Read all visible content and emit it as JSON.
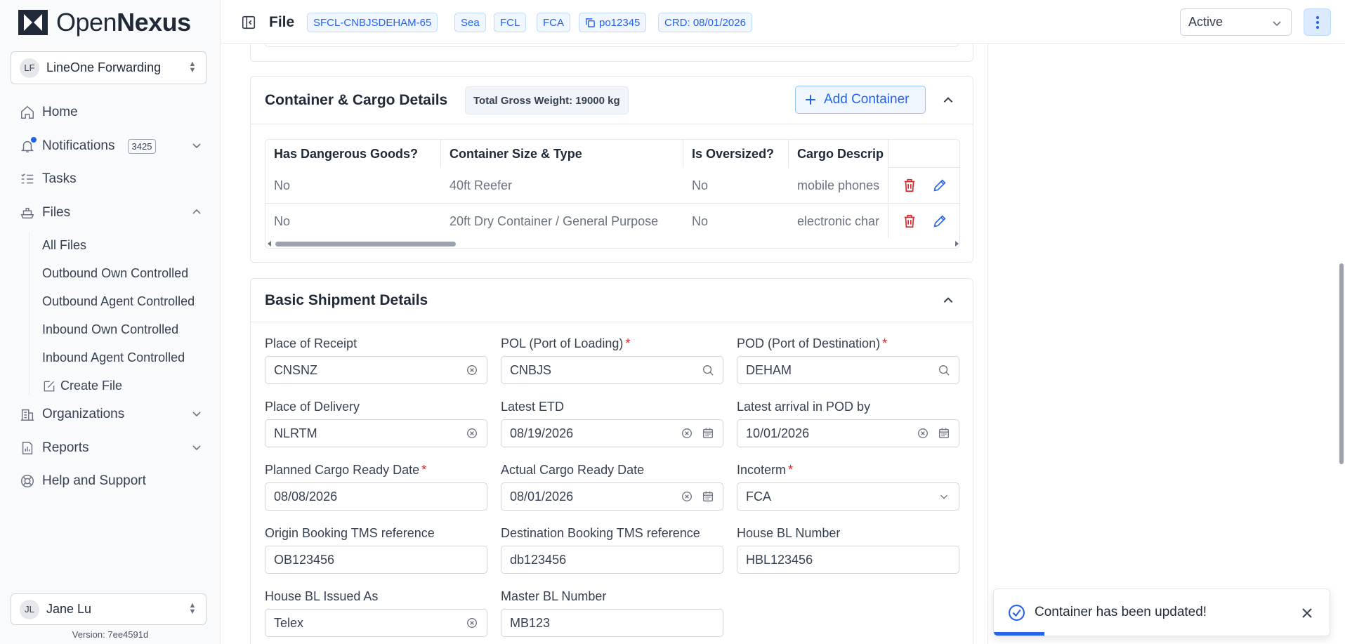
{
  "brand": {
    "name_light": "Open",
    "name_bold": "Nexus"
  },
  "org": {
    "initials": "LF",
    "name": "LineOne Forwarding"
  },
  "nav": {
    "home": "Home",
    "notifications": "Notifications",
    "notifications_count": "3425",
    "tasks": "Tasks",
    "files": "Files",
    "files_sub": [
      "All Files",
      "Outbound Own Controlled",
      "Outbound Agent Controlled",
      "Inbound Own Controlled",
      "Inbound Agent Controlled"
    ],
    "create_file": "Create File",
    "organizations": "Organizations",
    "reports": "Reports",
    "help": "Help and Support"
  },
  "user": {
    "initials": "JL",
    "name": "Jane Lu"
  },
  "version": "Version: 7ee4591d",
  "header": {
    "title": "File",
    "chips": [
      "SFCL-CNBJSDEHAM-65",
      "Sea",
      "FCL",
      "FCA",
      "po12345",
      "CRD: 08/01/2026"
    ],
    "status": "Active"
  },
  "containers": {
    "title": "Container & Cargo Details",
    "total_weight": "Total Gross Weight: 19000 kg",
    "add_label": "Add Container",
    "columns": [
      "Has Dangerous Goods?",
      "Container Size & Type",
      "Is Oversized?",
      "Cargo Descrip"
    ],
    "rows": [
      [
        "No",
        "40ft Reefer",
        "No",
        "mobile phones"
      ],
      [
        "No",
        "20ft Dry Container / General Purpose",
        "No",
        "electronic char"
      ]
    ]
  },
  "shipment": {
    "title": "Basic Shipment Details",
    "fields": [
      {
        "label": "Place of Receipt",
        "value": "CNSNZ",
        "required": false,
        "icons": "clear"
      },
      {
        "label": "POL (Port of Loading)",
        "value": "CNBJS",
        "required": true,
        "icons": "search"
      },
      {
        "label": "POD (Port of Destination)",
        "value": "DEHAM",
        "required": true,
        "icons": "search"
      },
      {
        "label": "Place of Delivery",
        "value": "NLRTM",
        "required": false,
        "icons": "clear"
      },
      {
        "label": "Latest ETD",
        "value": "08/19/2026",
        "required": false,
        "icons": "clear-date"
      },
      {
        "label": "Latest arrival in POD by",
        "value": "10/01/2026",
        "required": false,
        "icons": "clear-date"
      },
      {
        "label": "Planned Cargo Ready Date",
        "value": "08/08/2026",
        "required": true,
        "icons": "none"
      },
      {
        "label": "Actual Cargo Ready Date",
        "value": "08/01/2026",
        "required": false,
        "icons": "clear-date"
      },
      {
        "label": "Incoterm",
        "value": "FCA",
        "required": true,
        "icons": "chevron"
      },
      {
        "label": "Origin Booking TMS reference",
        "value": "OB123456",
        "required": false,
        "icons": "none"
      },
      {
        "label": "Destination Booking TMS reference",
        "value": "db123456",
        "required": false,
        "icons": "none"
      },
      {
        "label": "House BL Number",
        "value": "HBL123456",
        "required": false,
        "icons": "none"
      },
      {
        "label": "House BL Issued As",
        "value": "Telex",
        "required": false,
        "icons": "clear"
      },
      {
        "label": "Master BL Number",
        "value": "MB123",
        "required": false,
        "icons": "none"
      }
    ]
  },
  "toast": {
    "message": "Container has been updated!",
    "progress_fraction": 0.15
  },
  "colors": {
    "accent": "#2563eb",
    "danger": "#dc2626",
    "border": "#e5e7eb"
  }
}
